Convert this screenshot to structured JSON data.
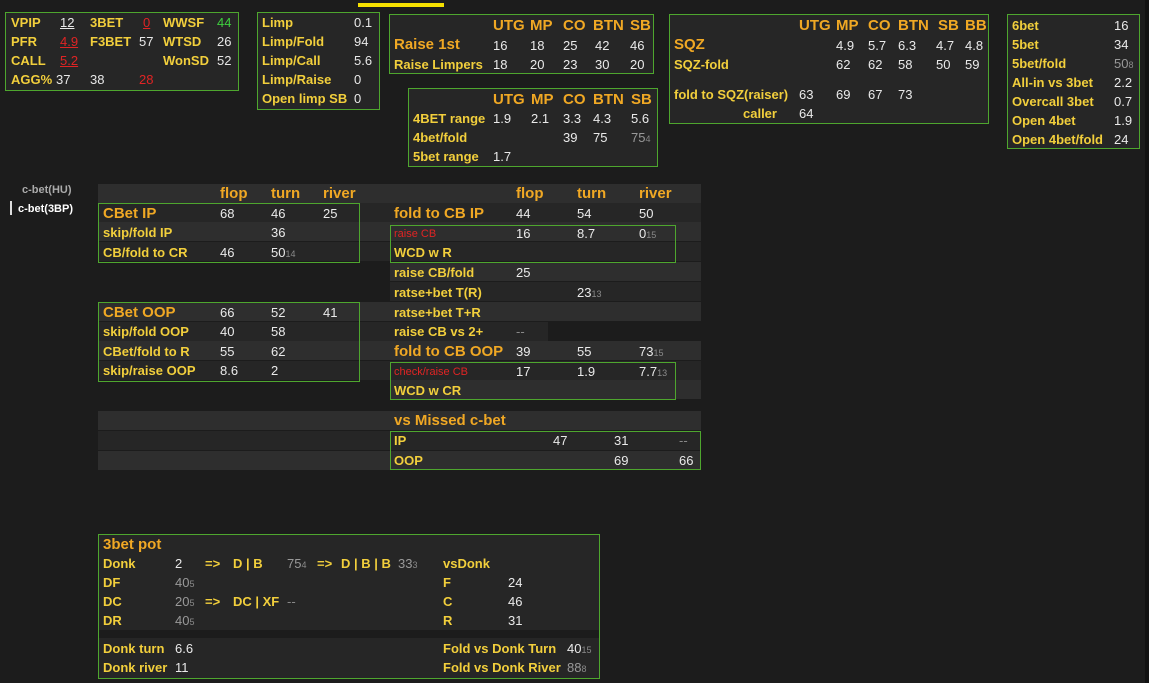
{
  "sidebar": {
    "items": [
      "c-bet(HU)",
      "c-bet(3BP)"
    ]
  },
  "basic": {
    "vpip_l": "VPIP",
    "vpip": "12",
    "threebet_l": "3BET",
    "threebet": "0",
    "wwsf_l": "WWSF",
    "wwsf": "44",
    "pfr_l": "PFR",
    "pfr": "4.9",
    "f3bet_l": "F3BET",
    "f3bet": "57",
    "wtsd_l": "WTSD",
    "wtsd": "26",
    "call_l": "CALL",
    "call": "5.2",
    "wonsd_l": "WonSD",
    "wonsd": "52",
    "agg_l": "AGG%",
    "agg1": "37",
    "agg2": "38",
    "agg3": "28"
  },
  "limp": {
    "rows": [
      [
        "Limp",
        "0.1"
      ],
      [
        "Limp/Fold",
        "94"
      ],
      [
        "Limp/Call",
        "5.6"
      ],
      [
        "Limp/Raise",
        "0"
      ],
      [
        "Open limp SB",
        "0"
      ]
    ]
  },
  "raise": {
    "cols": [
      "UTG",
      "MP",
      "CO",
      "BTN",
      "SB"
    ],
    "r1": [
      "Raise 1st",
      "16",
      "18",
      "25",
      "42",
      "46"
    ],
    "r2": [
      "Raise Limpers",
      "18",
      "20",
      "23",
      "30",
      "20"
    ]
  },
  "fourbet": {
    "cols": [
      "UTG",
      "MP",
      "CO",
      "BTN",
      "SB"
    ],
    "r1": [
      "4BET range",
      "1.9",
      "2.1",
      "3.3",
      "4.3",
      "5.6"
    ],
    "r2": [
      "4bet/fold",
      "39",
      "75",
      "75",
      "4"
    ],
    "r3": [
      "5bet range",
      "1.7"
    ]
  },
  "sqz": {
    "cols": [
      "UTG",
      "MP",
      "CO",
      "BTN",
      "SB",
      "BB"
    ],
    "r1": [
      "SQZ",
      "4.9",
      "5.7",
      "6.3",
      "4.7",
      "4.8"
    ],
    "r2": [
      "SQZ-fold",
      "62",
      "62",
      "58",
      "50",
      "59"
    ],
    "r3": [
      "fold to SQZ(raiser)",
      "63",
      "69",
      "67",
      "73"
    ],
    "r4": [
      "caller",
      "64"
    ]
  },
  "sixbet": {
    "rows": [
      [
        "6bet",
        "16",
        ""
      ],
      [
        "5bet",
        "34",
        ""
      ],
      [
        "5bet/fold",
        "50",
        "8"
      ],
      [
        "All-in vs 3bet",
        "2.2",
        ""
      ],
      [
        "Overcall 3bet",
        "0.7",
        ""
      ],
      [
        "Open 4bet",
        "1.9",
        ""
      ],
      [
        "Open 4bet/fold",
        "24",
        ""
      ]
    ]
  },
  "cbet": {
    "h": [
      "flop",
      "turn",
      "river"
    ],
    "ip": [
      "CBet IP",
      "68",
      "46",
      "25"
    ],
    "skip_ip": [
      "skip/fold IP",
      "36"
    ],
    "cbf_cr": [
      "CB/fold to CR",
      "46",
      "50",
      "14"
    ],
    "oop": [
      "CBet OOP",
      "66",
      "52",
      "41"
    ],
    "skip_oop": [
      "skip/fold OOP",
      "40",
      "58"
    ],
    "cbf_r": [
      "CBet/fold to R",
      "55",
      "62"
    ],
    "skipraise": [
      "skip/raise OOP",
      "8.6",
      "2"
    ]
  },
  "fold": {
    "h": [
      "flop",
      "turn",
      "river"
    ],
    "ip": [
      "fold to CB IP",
      "44",
      "54",
      "50"
    ],
    "raise": [
      "raise CB",
      "16",
      "8.7",
      "0",
      "15"
    ],
    "wcd": [
      "WCD w R"
    ],
    "raise_fold": [
      "raise CB/fold",
      "25"
    ],
    "ratse_tr": [
      "ratse+bet T(R)",
      "23",
      "13"
    ],
    "ratse_tr2": [
      "ratse+bet T+R"
    ],
    "raise_vs2": [
      "raise CB vs 2+",
      "--"
    ],
    "oop": [
      "fold to CB OOP",
      "39",
      "55",
      "73",
      "15"
    ],
    "chk_raise": [
      "check/raise CB",
      "17",
      "1.9",
      "7.7",
      "13"
    ],
    "wcd_cr": [
      "WCD w CR"
    ]
  },
  "missed": {
    "title": "vs Missed c-bet",
    "ip": [
      "IP",
      "47",
      "31",
      "--"
    ],
    "oop": [
      "OOP",
      "69",
      "66"
    ]
  },
  "pot3": {
    "title": "3bet pot",
    "donk": [
      "Donk",
      "2",
      "=>",
      "D | B",
      "75",
      "4",
      "=>",
      "D | B | B",
      "33",
      "3"
    ],
    "df": [
      "DF",
      "40",
      "5"
    ],
    "dc": [
      "DC",
      "20",
      "5",
      "=>",
      "DC | XF",
      "--"
    ],
    "dr": [
      "DR",
      "40",
      "5"
    ],
    "dturn": [
      "Donk turn",
      "6.6"
    ],
    "driver": [
      "Donk river",
      "11"
    ],
    "vsdonk": "vsDonk",
    "f": [
      "F",
      "24"
    ],
    "c": [
      "C",
      "46"
    ],
    "r": [
      "R",
      "31"
    ],
    "fturn": [
      "Fold vs Donk Turn",
      "40",
      "15"
    ],
    "friver": [
      "Fold vs Donk River",
      "88",
      "8"
    ]
  }
}
